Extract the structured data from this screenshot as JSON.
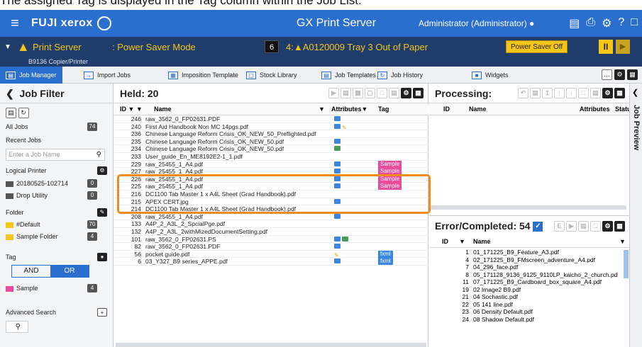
{
  "caption": "The assigned Tag is displayed in the Tag column within the Job List.",
  "topbar": {
    "brand": "FUJI xerox",
    "title": "GX Print Server",
    "user": "Administrator (Administrator)",
    "icons": [
      "user-icon",
      "print-icon",
      "printer-icon",
      "gear-icon",
      "help-icon",
      "window-icon"
    ]
  },
  "status": {
    "printer": "Print Server",
    "mode": ": Power Saver Mode",
    "count": "6",
    "alert": "4:▲A0120009 Tray 3 Out of Paper",
    "power_saver_off": "Power Saver Off",
    "subtitle": "B9136 Copier/Printer"
  },
  "tabs": [
    "Job Manager",
    "Import Jobs",
    "Imposition Template",
    "Stock Library",
    "Job Templates",
    "Job History",
    "Widgets"
  ],
  "left": {
    "title": "Job Filter",
    "all_jobs": "All Jobs",
    "all_jobs_count": "74",
    "recent_jobs": "Recent Jobs",
    "job_name_placeholder": "Enter a Job Name",
    "logical_printer": "Logical Printer",
    "printer_1": "20180525-102714",
    "printer_1_count": "0",
    "printer_2": "Drop Utility",
    "printer_2_count": "0",
    "folder": "Folder",
    "folder_default": "#Default",
    "folder_default_count": "70",
    "folder_sample": "Sample Folder",
    "folder_sample_count": "4",
    "tag": "Tag",
    "and": "AND",
    "or": "OR",
    "tag_sample": "Sample",
    "tag_sample_count": "4",
    "advanced_search": "Advanced Search"
  },
  "held": {
    "title": "Held: 20",
    "col_id": "ID",
    "col_name": "Name",
    "col_attributes": "Attributes",
    "col_tag": "Tag",
    "rows": [
      {
        "id": "246",
        "name": "raw_3562_0_FP02631.PDF",
        "tag": ""
      },
      {
        "id": "240",
        "name": "First Aid Handbook Non MC 14pgs.pdf",
        "tag": ""
      },
      {
        "id": "236",
        "name": "Chinese Language Reform Crisis_OK_NEW_50_Preflighted.pdf",
        "tag": ""
      },
      {
        "id": "235",
        "name": "Chinese Language Reform Crisis_OK_NEW_50.pdf",
        "tag": ""
      },
      {
        "id": "234",
        "name": "Chinese Language Reform Crisis_OK_NEW_50.pdf",
        "tag": ""
      },
      {
        "id": "233",
        "name": "User_guide_En_ME8192E2-1_1.pdf",
        "tag": ""
      },
      {
        "id": "229",
        "name": "raw_25455_1_A4.pdf",
        "tag": "Sample"
      },
      {
        "id": "227",
        "name": "raw_25455_1_A4.pdf",
        "tag": "Sample"
      },
      {
        "id": "226",
        "name": "raw_25455_1_A4.pdf",
        "tag": "Sample"
      },
      {
        "id": "225",
        "name": "raw_25455_1_A4.pdf",
        "tag": "Sample"
      },
      {
        "id": "216",
        "name": "DC1100 Tab Master 1 x A4L Sheet (Grad Handbook).pdf",
        "tag": ""
      },
      {
        "id": "215",
        "name": "APEX CERT.jpg",
        "tag": ""
      },
      {
        "id": "214",
        "name": "DC1100 Tab Master 1 x A4L Sheet (Grad Handbook).pdf",
        "tag": ""
      },
      {
        "id": "208",
        "name": "raw_25455_1_A4.pdf",
        "tag": ""
      },
      {
        "id": "133",
        "name": "A4P_2_A3L_2_SpcialPge.pdf",
        "tag": ""
      },
      {
        "id": "132",
        "name": "A4P_2_A3L_2withMizedDocumentSetting.pdf",
        "tag": ""
      },
      {
        "id": "101",
        "name": "raw_3562_0_FP02631.PS",
        "tag": ""
      },
      {
        "id": "82",
        "name": "raw_3562_0_FP02631.PDF",
        "tag": ""
      },
      {
        "id": "56",
        "name": "pocket guide.pdf",
        "tag": "fxml"
      },
      {
        "id": "6",
        "name": "03_Y327_B9 series_APPE.pdf",
        "tag": "fxml"
      }
    ]
  },
  "processing": {
    "title": "Processing:",
    "col_id": "ID",
    "col_name": "Name",
    "col_attributes": "Attributes",
    "col_status": "Statu"
  },
  "errors": {
    "title": "Error/Completed: 54",
    "col_id": "ID",
    "col_name": "Name",
    "rows": [
      {
        "id": "1",
        "name": "01_171225_B9_Feature_A3.pdf"
      },
      {
        "id": "4",
        "name": "02_171225_B9_FMscreen_adventure_A4.pdf"
      },
      {
        "id": "7",
        "name": "04_296_face.pdf"
      },
      {
        "id": "8",
        "name": "05_171128_9136_9125_9110LP_kaicho_2_church.pd"
      },
      {
        "id": "11",
        "name": "07_171225_B9_Cardboard_box_square_A4.pdf"
      },
      {
        "id": "19",
        "name": "02 Image2 B9.pdf"
      },
      {
        "id": "21",
        "name": "04 Sochastic.pdf"
      },
      {
        "id": "22",
        "name": "05 141 line.pdf"
      },
      {
        "id": "23",
        "name": "06 Density Default.pdf"
      },
      {
        "id": "24",
        "name": "08 Shadow Default.pdf"
      }
    ]
  },
  "preview_label": "Job Preview",
  "colors": {
    "brand_blue": "#2b6fce",
    "status_navy": "#1f3c6b",
    "warn_yellow": "#f5c518",
    "tag_pink": "#e84c9b",
    "tag_blue": "#3a86e0",
    "highlight_orange": "#f28a20"
  }
}
